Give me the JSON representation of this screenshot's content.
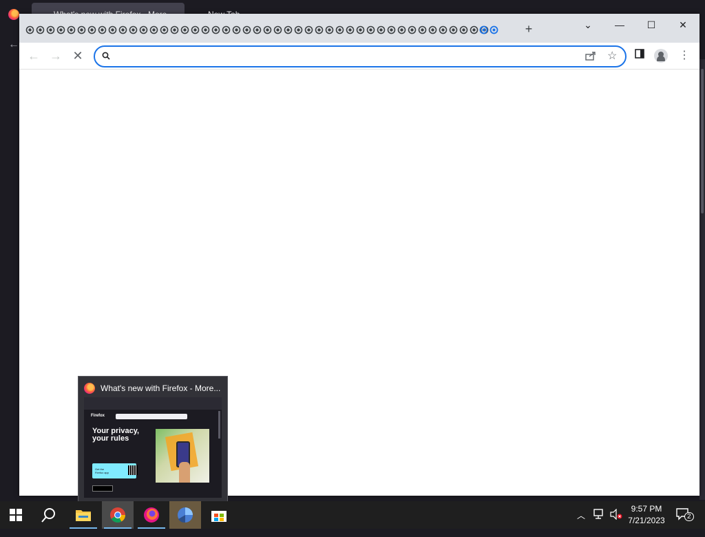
{
  "background_window": {
    "tab1_title": "What's new with Firefox - More...",
    "tab2_title": "New Tab"
  },
  "chrome": {
    "tab_count_visible": 47,
    "new_tab_label": "+",
    "address_bar": {
      "value": "",
      "placeholder": ""
    },
    "accent_color": "#1a73e8"
  },
  "preview": {
    "title": "What's new with Firefox - More...",
    "thumb_brand": "Firefox",
    "thumb_heading": "Your privacy, your rules",
    "thumb_cta": "Get the Firefox app"
  },
  "taskbar": {
    "time": "9:57 PM",
    "date": "7/21/2023",
    "notification_count": "2",
    "apps": [
      "start",
      "search",
      "file-explorer",
      "chrome",
      "firefox",
      "app",
      "store"
    ]
  }
}
